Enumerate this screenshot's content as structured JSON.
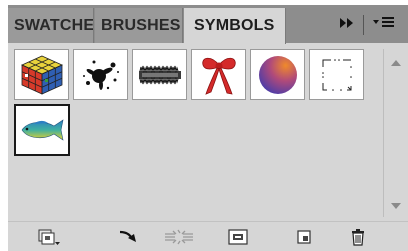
{
  "tabs": [
    {
      "label": "SWATCHES"
    },
    {
      "label": "BRUSHES"
    },
    {
      "label": "SYMBOLS"
    }
  ],
  "tabbar": {
    "collapse_glyph": "▸▸",
    "menu_glyph": "☰",
    "menu_glyph_prefix": "▾"
  },
  "symbols": [
    {
      "name": "cube-icon"
    },
    {
      "name": "ink-splat-icon"
    },
    {
      "name": "grass-border-icon"
    },
    {
      "name": "red-ribbon-bow-icon"
    },
    {
      "name": "gradient-sphere-icon"
    },
    {
      "name": "dotted-frame-icon"
    },
    {
      "name": "fish-icon",
      "selected": true
    }
  ],
  "toolbar": {
    "buttons": [
      {
        "name": "symbol-libraries-menu-icon"
      },
      {
        "name": "place-symbol-instance-icon"
      },
      {
        "name": "break-link-to-symbol-icon"
      },
      {
        "name": "symbol-options-icon"
      },
      {
        "name": "new-symbol-icon"
      },
      {
        "name": "delete-symbol-icon"
      }
    ]
  },
  "colors": {
    "panel_bg": "#d6d6d6",
    "tabbar_bg": "#8d8d8d",
    "tab_inactive": "#9a9a9a"
  }
}
